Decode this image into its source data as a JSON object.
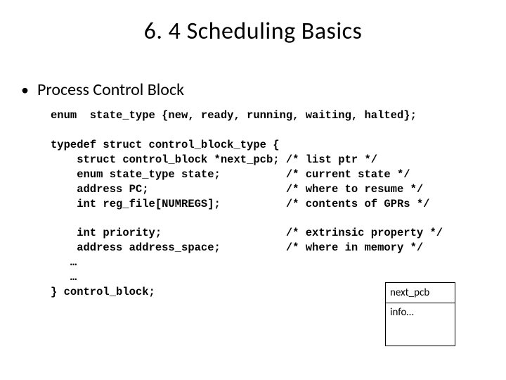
{
  "title": "6. 4 Scheduling Basics",
  "bullet": "Process Control Block",
  "code": "enum  state_type {new, ready, running, waiting, halted};\n\ntypedef struct control_block_type {\n    struct control_block *next_pcb; /* list ptr */\n    enum state_type state;          /* current state */\n    address PC;                     /* where to resume */\n    int reg_file[NUMREGS];          /* contents of GPRs */\n\n    int priority;                   /* extrinsic property */\n    address address_space;          /* where in memory */\n   …\n   …\n} control_block;",
  "diagram": {
    "top": "next_pcb",
    "bottom": "info…"
  }
}
